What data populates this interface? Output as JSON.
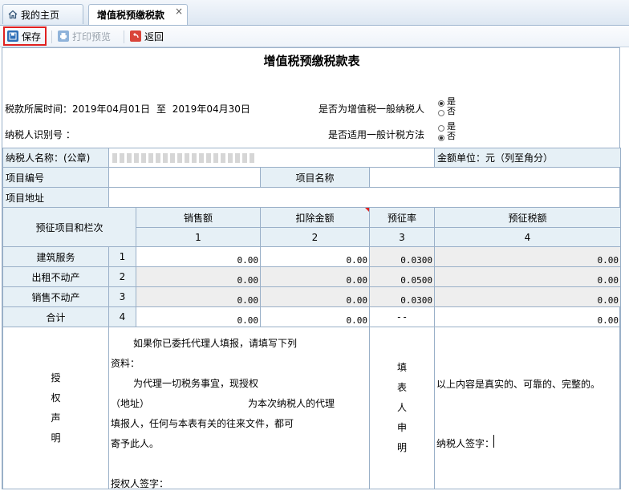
{
  "tabs": [
    {
      "label": "我的主页"
    },
    {
      "label": "增值税预缴税款",
      "close": "×"
    }
  ],
  "toolbar": {
    "save": "保存",
    "print": "打印预览",
    "back": "返回"
  },
  "form": {
    "title": "增值税预缴税款表",
    "period_label": "税款所属时间：",
    "period_from": "2019年04月01日",
    "period_to_word": "至",
    "period_to": "2019年04月30日",
    "general_taxpayer_q": "是否为增值税一般纳税人",
    "general_method_q": "是否适用一般计税方法",
    "yes": "是",
    "no": "否",
    "general_taxpayer_selected": "是",
    "general_method_selected": "否",
    "taxpayer_id_label": "纳税人识别号 ：",
    "taxpayer_name_label": "纳税人名称：(公章)",
    "amount_unit": "金额单位：元（列至角分）",
    "project_no_label": "项目编号",
    "project_name_label": "项目名称",
    "project_addr_label": "项目地址",
    "col_item_header": "预征项目和栏次",
    "columns": [
      {
        "name": "销售额",
        "no": "1"
      },
      {
        "name": "扣除金额",
        "no": "2"
      },
      {
        "name": "预征率",
        "no": "3"
      },
      {
        "name": "预征税额",
        "no": "4"
      }
    ],
    "rows": [
      {
        "name": "建筑服务",
        "no": "1",
        "sales": "0.00",
        "deduct": "0.00",
        "rate": "0.0300",
        "tax": "0.00"
      },
      {
        "name": "出租不动产",
        "no": "2",
        "sales": "0.00",
        "deduct": "0.00",
        "rate": "0.0500",
        "tax": "0.00"
      },
      {
        "name": "销售不动产",
        "no": "3",
        "sales": "0.00",
        "deduct": "0.00",
        "rate": "0.0300",
        "tax": "0.00"
      },
      {
        "name": "合计",
        "no": "4",
        "sales": "0.00",
        "deduct": "0.00",
        "rate": "--",
        "tax": "0.00"
      }
    ],
    "auth_label_chars": [
      "授",
      "权",
      "声",
      "明"
    ],
    "auth_lines": [
      "如果你已委托代理人填报，请填写下列",
      "资料：",
      "为代理一切税务事宜，现授权",
      "（地址）",
      "为本次纳税人的代理",
      "填报人，任何与本表有关的往来文件，都可",
      "寄予此人。",
      "授权人签字："
    ],
    "filler_label_chars": [
      "填",
      "表",
      "人",
      "申",
      "明"
    ],
    "declaration_text": "以上内容是真实的、可靠的、完整的。",
    "signature_label": "纳税人签字："
  }
}
